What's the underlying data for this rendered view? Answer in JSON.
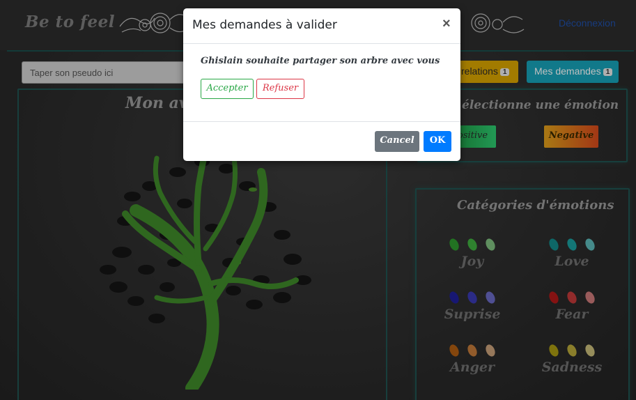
{
  "navbar": {
    "brand": "Be to feel",
    "logout_label": "Déconnexion"
  },
  "search": {
    "placeholder": "Taper son pseudo ici"
  },
  "toolbar": {
    "relations_label": "relations",
    "relations_count": "1",
    "demandes_label": "Mes demandes",
    "demandes_count": "1"
  },
  "avatar_panel": {
    "title": "Mon ava"
  },
  "emotion_panel": {
    "title": "électionne une émotion",
    "positive_label": "ositive",
    "negative_label": "Negative"
  },
  "categories_panel": {
    "title": "Catégories d'émotions",
    "items": [
      {
        "label": "Joy",
        "leaf_colors": [
          "#2e9a2e",
          "#3fae3f",
          "#7fbf7f"
        ]
      },
      {
        "label": "Love",
        "leaf_colors": [
          "#138a8a",
          "#1a9e9e",
          "#5cb8b8"
        ]
      },
      {
        "label": "Suprise",
        "leaf_colors": [
          "#1f1f9a",
          "#3a3ab3",
          "#6a6ac4"
        ]
      },
      {
        "label": "Fear",
        "leaf_colors": [
          "#b01818",
          "#c23a3a",
          "#cc7a7a"
        ]
      },
      {
        "label": "Anger",
        "leaf_colors": [
          "#b05e12",
          "#c27a3a",
          "#c9a07a"
        ]
      },
      {
        "label": "Sadness",
        "leaf_colors": [
          "#a89a12",
          "#b8a83a",
          "#c8bc7a"
        ]
      }
    ]
  },
  "modal": {
    "title": "Mes demandes à valider",
    "close_symbol": "×",
    "request_text": "Ghislain souhaite partager son arbre avec vous",
    "accept_label": "Accepter",
    "refuse_label": "Refuser",
    "cancel_label": "Cancel",
    "ok_label": "OK"
  },
  "colors": {
    "accent_teal": "#17a2b8",
    "accent_yellow": "#d9a400",
    "tree_green": "#3f8a2a",
    "accept_green": "#28a745",
    "refuse_red": "#dc3545",
    "ok_blue": "#007bff"
  }
}
